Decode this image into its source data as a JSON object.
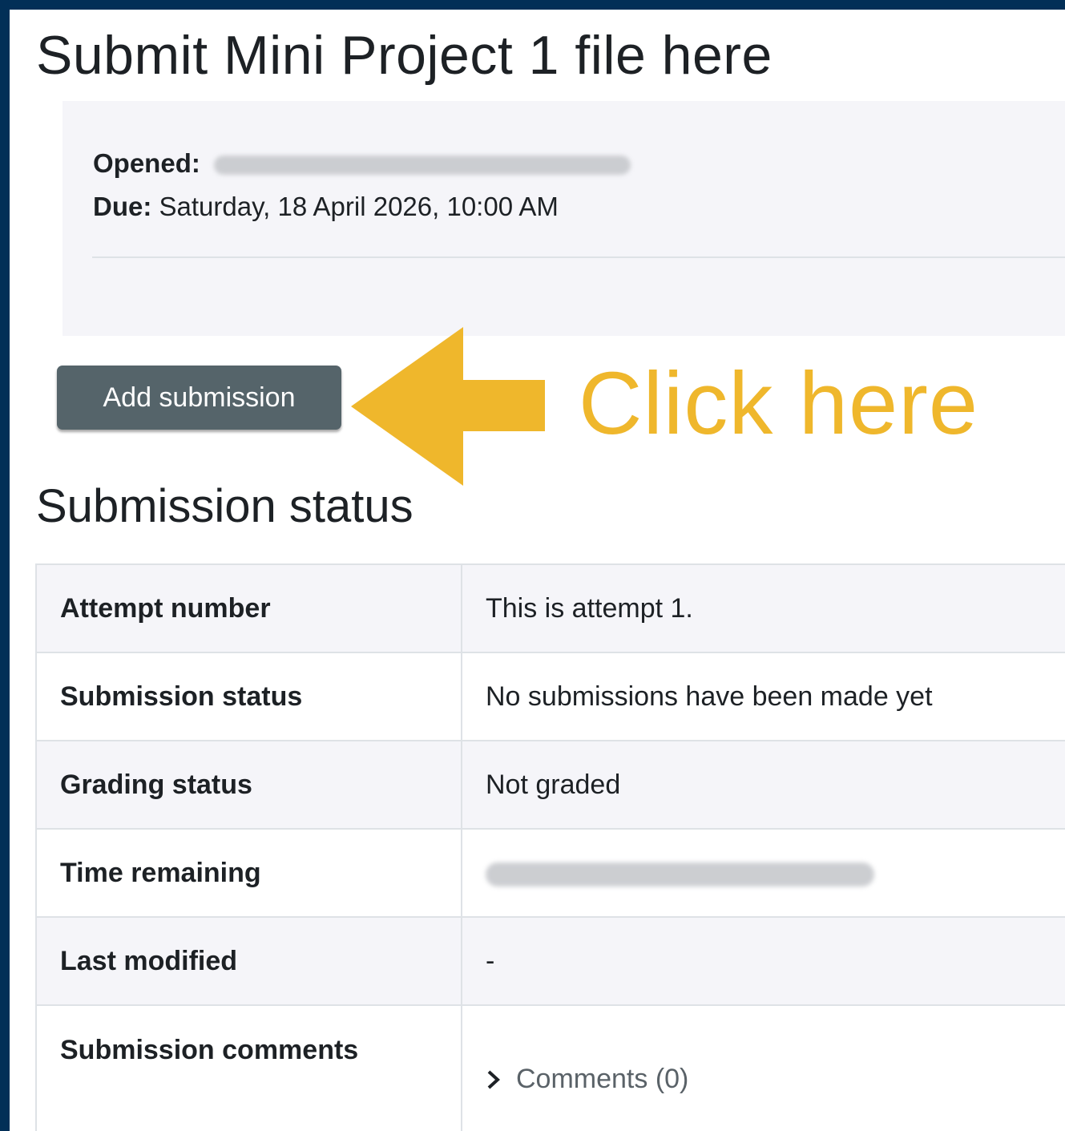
{
  "page": {
    "title": "Submit Mini Project 1 file here"
  },
  "dates": {
    "opened_label": "Opened:",
    "due_label": "Due:",
    "due_value": "Saturday, 18 April 2026, 10:00 AM"
  },
  "actions": {
    "add_submission_label": "Add submission"
  },
  "annotation": {
    "text": "Click here",
    "color": "#efb72c"
  },
  "status_section": {
    "title": "Submission status",
    "rows": [
      {
        "label": "Attempt number",
        "value": "This is attempt 1."
      },
      {
        "label": "Submission status",
        "value": "No submissions have been made yet"
      },
      {
        "label": "Grading status",
        "value": "Not graded"
      },
      {
        "label": "Time remaining",
        "value": ""
      },
      {
        "label": "Last modified",
        "value": "-"
      },
      {
        "label": "Submission comments",
        "value": "Comments (0)"
      }
    ]
  },
  "colors": {
    "frame": "#022f57",
    "button": "#55646a",
    "panel": "#f5f5f9"
  },
  "icons": {
    "comments_toggle": "chevron-right-icon",
    "pointer": "arrow-left-icon"
  }
}
